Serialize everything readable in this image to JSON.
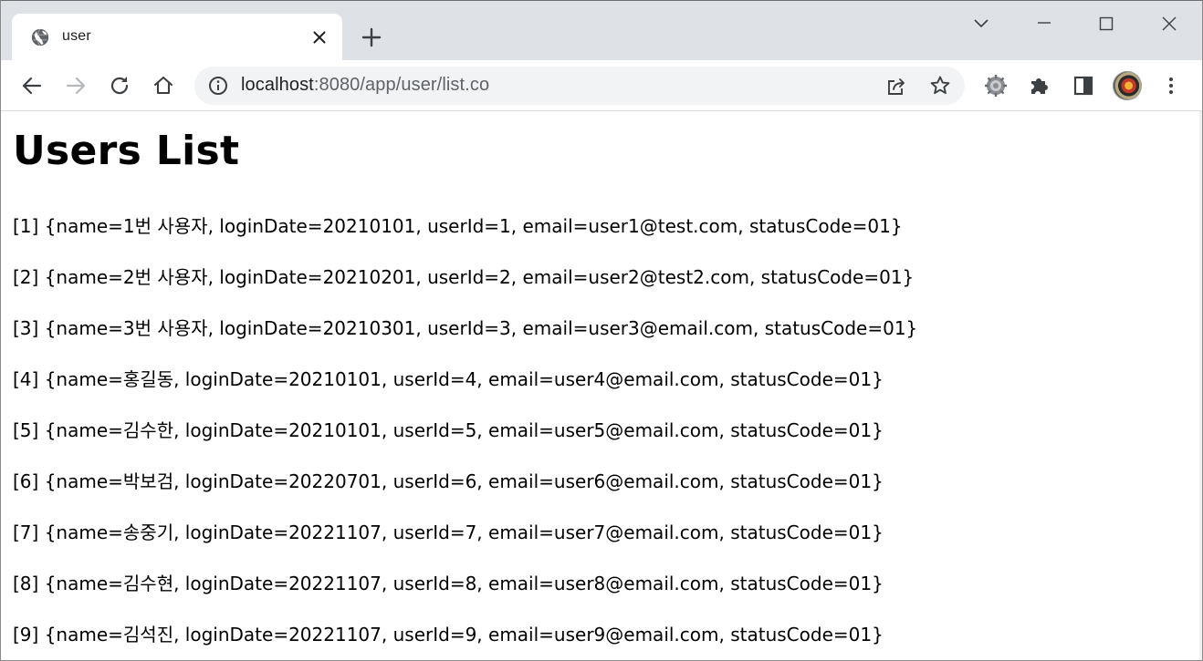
{
  "tab": {
    "title": "user"
  },
  "address_bar": {
    "host": "localhost",
    "path": ":8080/app/user/list.co"
  },
  "icons": {
    "favicon": "globe-icon",
    "close": "close-icon",
    "new_tab": "plus-icon",
    "back": "back-arrow-icon",
    "forward": "forward-arrow-icon",
    "reload": "reload-icon",
    "home": "home-icon",
    "site_info": "info-icon",
    "share": "share-icon",
    "bookmark": "star-icon",
    "extension_settings": "gear-icon",
    "extensions": "puzzle-icon",
    "side_panel": "side-panel-icon",
    "menu": "kebab-menu-icon"
  },
  "page": {
    "title": "Users List",
    "users": [
      "[1] {name=1번 사용자, loginDate=20210101, userId=1, email=user1@test.com, statusCode=01}",
      "[2] {name=2번 사용자, loginDate=20210201, userId=2, email=user2@test2.com, statusCode=01}",
      "[3] {name=3번 사용자, loginDate=20210301, userId=3, email=user3@email.com, statusCode=01}",
      "[4] {name=홍길동, loginDate=20210101, userId=4, email=user4@email.com, statusCode=01}",
      "[5] {name=김수한, loginDate=20210101, userId=5, email=user5@email.com, statusCode=01}",
      "[6] {name=박보검, loginDate=20220701, userId=6, email=user6@email.com, statusCode=01}",
      "[7] {name=송중기, loginDate=20221107, userId=7, email=user7@email.com, statusCode=01}",
      "[8] {name=김수현, loginDate=20221107, userId=8, email=user8@email.com, statusCode=01}",
      "[9] {name=김석진, loginDate=20221107, userId=9, email=user9@email.com, statusCode=01}"
    ]
  },
  "colors": {
    "tabstrip_bg": "#dee1e6",
    "omnibox_bg": "#f1f3f4",
    "icon": "#5f6368",
    "text": "#000000"
  }
}
